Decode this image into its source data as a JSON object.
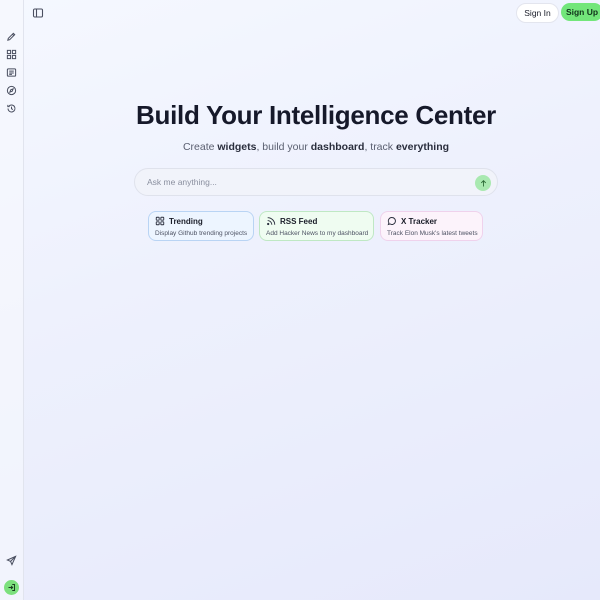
{
  "header": {
    "signin_label": "Sign In",
    "signup_label": "Sign Up"
  },
  "hero": {
    "title": "Build Your Intelligence Center",
    "subtitle_parts": [
      "Create ",
      "widgets",
      ", build your ",
      "dashboard",
      ", track ",
      "everything"
    ]
  },
  "search": {
    "placeholder": "Ask me anything...",
    "value": ""
  },
  "suggestions": [
    {
      "title": "Trending",
      "description": "Display Github trending projects",
      "icon": "grid-icon"
    },
    {
      "title": "RSS Feed",
      "description": "Add Hacker News to my dashboard",
      "icon": "rss-icon"
    },
    {
      "title": "X Tracker",
      "description": "Track Elon Musk's latest tweets",
      "icon": "chat-bubble-icon"
    }
  ],
  "sidebar": {
    "icons": [
      "edit-icon",
      "widgets-icon",
      "newspaper-icon",
      "compass-icon",
      "history-icon"
    ],
    "bottom_icons": [
      "send-icon",
      "login-icon"
    ]
  },
  "colors": {
    "accent": "#72e67a",
    "background": "#eef1fd"
  }
}
